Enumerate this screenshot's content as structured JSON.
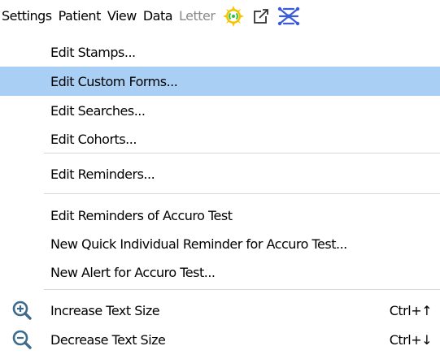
{
  "menubar": {
    "items": [
      {
        "label": "Settings",
        "state": "active"
      },
      {
        "label": "Patient",
        "state": "normal"
      },
      {
        "label": "View",
        "state": "normal"
      },
      {
        "label": "Data",
        "state": "normal"
      },
      {
        "label": "Letter",
        "state": "disabled"
      }
    ],
    "icons": [
      "broadcast-icon",
      "external-link-icon",
      "network-icon"
    ],
    "colors": {
      "disabled_text": "#8a8a8a",
      "broadcast_yellow": "#f5c400",
      "broadcast_green": "#2dbf3a",
      "network_blue": "#3a5bd9"
    }
  },
  "dropdown": {
    "highlight_color": "#a9cff4",
    "items": [
      {
        "label": "Edit Stamps..."
      },
      {
        "label": "Edit Custom Forms...",
        "highlighted": true
      },
      {
        "label": "Edit Searches..."
      },
      {
        "label": "Edit Cohorts..."
      },
      {
        "label": "Edit Reminders..."
      },
      {
        "label": "Edit Reminders of Accuro Test"
      },
      {
        "label": "New Quick Individual Reminder for Accuro Test..."
      },
      {
        "label": "New Alert for Accuro Test..."
      },
      {
        "label": "Increase Text Size",
        "shortcut": "Ctrl+↑",
        "icon": "zoom-in-icon"
      },
      {
        "label": "Decrease Text Size",
        "shortcut": "Ctrl+↓",
        "icon": "zoom-out-icon"
      }
    ]
  }
}
